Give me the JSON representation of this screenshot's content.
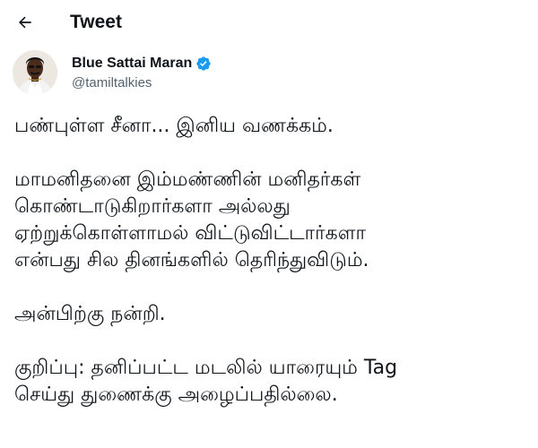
{
  "header": {
    "title": "Tweet",
    "back_icon": "arrow-left-icon"
  },
  "author": {
    "display_name": "Blue Sattai Maran",
    "handle": "@tamiltalkies",
    "verified_icon": "verified-badge-icon",
    "verified_color": "#1d9bf0"
  },
  "tweet": {
    "paragraphs": [
      "பண்புள்ள சீனா... இனிய வணக்கம்.",
      "மாமனிதனை இம்மண்ணின் மனிதர்கள்\nகொண்டாடுகிறார்களா அல்லது\nஏற்றுக்கொள்ளாமல் விட்டுவிட்டார்களா\nஎன்பது சில தினங்களில் தெரிந்துவிடும்.",
      "அன்பிற்கு நன்றி.",
      "குறிப்பு: தனிப்பட்ட மடலில் யாரையும் Tag\nசெய்து துணைக்கு அழைப்பதில்லை."
    ]
  },
  "colors": {
    "text": "#0f1419",
    "secondary_text": "#536471",
    "background": "#ffffff"
  }
}
